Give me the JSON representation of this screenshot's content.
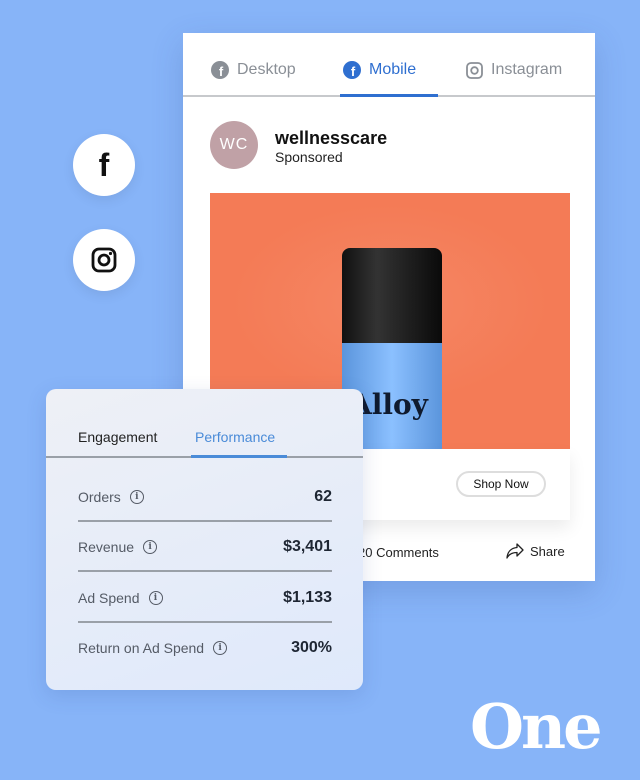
{
  "social": [
    {
      "icon": "facebook-icon"
    },
    {
      "icon": "instagram-icon"
    }
  ],
  "preview": {
    "tabs": [
      {
        "label": "Desktop",
        "icon": "facebook-icon"
      },
      {
        "label": "Mobile",
        "icon": "facebook-icon",
        "active": true
      },
      {
        "label": "Instagram",
        "icon": "instagram-icon"
      }
    ],
    "avatar_initials": "WC",
    "account_name": "wellnesscare",
    "sponsored": "Sponsored",
    "product_label": "Alloy",
    "cta": "Shop Now",
    "comments": "20 Comments",
    "share": "Share"
  },
  "metrics": {
    "tabs": [
      {
        "label": "Engagement"
      },
      {
        "label": "Performance",
        "active": true
      }
    ],
    "rows": [
      {
        "label": "Orders",
        "value": "62"
      },
      {
        "label": "Revenue",
        "value": "$3,401"
      },
      {
        "label": "Ad Spend",
        "value": "$1,133"
      },
      {
        "label": "Return on Ad Spend",
        "value": "300%"
      }
    ]
  },
  "brand": {
    "logo": "One"
  },
  "colors": {
    "background": "#87b4f8",
    "accent": "#2f6fd0",
    "ad_image": "#f47b56"
  }
}
